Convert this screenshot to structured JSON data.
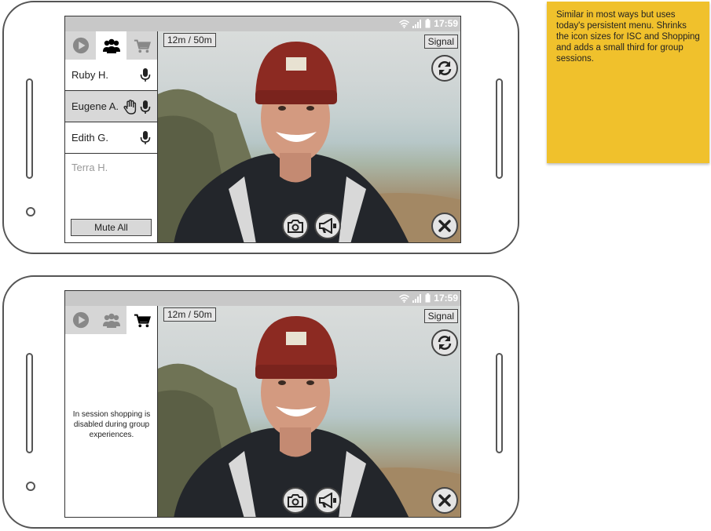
{
  "status_bar": {
    "time": "17:59"
  },
  "video": {
    "timer": "12m / 50m",
    "signal_label": "Signal"
  },
  "phone1": {
    "participants": [
      {
        "name": "Ruby H.",
        "raised_hand": false,
        "mic": true
      },
      {
        "name": "Eugene A.",
        "raised_hand": true,
        "mic": true
      },
      {
        "name": "Edith G.",
        "raised_hand": false,
        "mic": true
      },
      {
        "name": "Terra H.",
        "raised_hand": false,
        "mic": false
      }
    ],
    "mute_all_label": "Mute All"
  },
  "phone2": {
    "disabled_message": "In session shopping is disabled during group experiences."
  },
  "sticky_note": {
    "text": "Similar in most ways but uses today's persistent menu. Shrinks the icon sizes for ISC and Shopping and adds a small third for group sessions."
  },
  "icons": [
    "play-icon",
    "group-icon",
    "cart-icon",
    "mic-icon",
    "raised-hand-icon",
    "refresh-icon",
    "close-icon",
    "camera-icon",
    "megaphone-icon",
    "wifi-icon",
    "signal-bars-icon",
    "battery-icon"
  ],
  "colors": {
    "sticky": "#f0c12c",
    "tab_inactive": "#d6d6d6",
    "highlight_row": "#d8d8d8"
  }
}
